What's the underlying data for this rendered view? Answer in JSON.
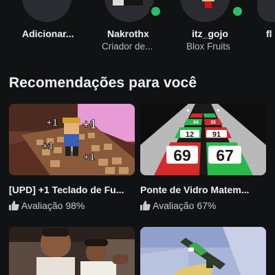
{
  "friends": [
    {
      "name": "Adicionar...",
      "sub": "",
      "online": false
    },
    {
      "name": "Nakrothx",
      "sub": "Criador de...",
      "online": true
    },
    {
      "name": "itz_gojo",
      "sub": "Blox Fruits",
      "online": true
    },
    {
      "name": "fl",
      "sub": "",
      "online": false
    }
  ],
  "section": {
    "title": "Recomendações para você"
  },
  "games": [
    {
      "title": "[UPD] +1 Teclado de Fu...",
      "rating": "Avaliação 98%",
      "thumb_text": [
        "+1",
        "+1",
        "+1",
        "+1"
      ]
    },
    {
      "title": "Ponte de Vidro Matem...",
      "rating": "Avaliação 67%",
      "thumb_text": [
        "12",
        "91",
        "69",
        "67",
        "84",
        "35"
      ]
    },
    {
      "title": "",
      "rating": ""
    },
    {
      "title": "",
      "rating": ""
    }
  ],
  "colors": {
    "background": "#111214",
    "online": "#2dbf63",
    "text_primary": "#f1f2f3",
    "text_secondary": "#b9bbbe"
  }
}
